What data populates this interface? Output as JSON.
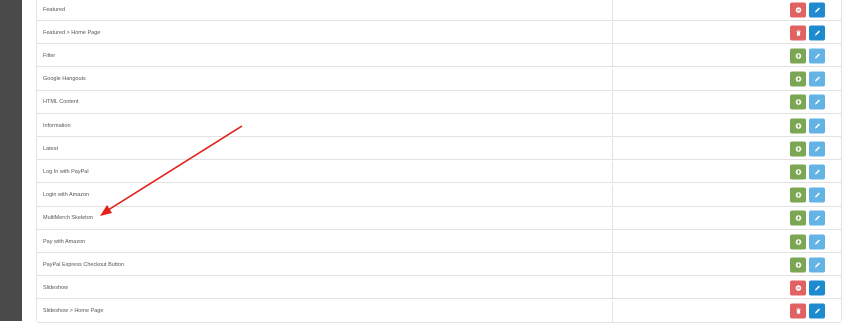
{
  "colors": {
    "sidebar": "#4a4a4a",
    "danger": "#e06262",
    "success": "#7ba653",
    "primary": "#1e8acf",
    "info": "#63b3e5",
    "arrow": "#e3201b"
  },
  "rows": [
    {
      "name": "Featured",
      "status_action": "uninstall",
      "status_icon": "minus-circle-icon",
      "edit_enabled": true
    },
    {
      "name": "Featured > Home Page",
      "status_action": "delete",
      "status_icon": "trash-icon",
      "edit_enabled": true
    },
    {
      "name": "Filter",
      "status_action": "install",
      "status_icon": "plus-circle-icon",
      "edit_enabled": false
    },
    {
      "name": "Google Hangouts",
      "status_action": "install",
      "status_icon": "plus-circle-icon",
      "edit_enabled": false
    },
    {
      "name": "HTML Content",
      "status_action": "install",
      "status_icon": "plus-circle-icon",
      "edit_enabled": false
    },
    {
      "name": "Information",
      "status_action": "install",
      "status_icon": "plus-circle-icon",
      "edit_enabled": false
    },
    {
      "name": "Latest",
      "status_action": "install",
      "status_icon": "plus-circle-icon",
      "edit_enabled": false
    },
    {
      "name": "Log In with PayPal",
      "status_action": "install",
      "status_icon": "plus-circle-icon",
      "edit_enabled": false
    },
    {
      "name": "Login with Amazon",
      "status_action": "install",
      "status_icon": "plus-circle-icon",
      "edit_enabled": false
    },
    {
      "name": "MultiMerch Skeleton",
      "status_action": "install",
      "status_icon": "plus-circle-icon",
      "edit_enabled": false
    },
    {
      "name": "Pay with Amazon",
      "status_action": "install",
      "status_icon": "plus-circle-icon",
      "edit_enabled": false
    },
    {
      "name": "PayPal Express Checkout Button",
      "status_action": "install",
      "status_icon": "plus-circle-icon",
      "edit_enabled": false
    },
    {
      "name": "Slideshow",
      "status_action": "uninstall",
      "status_icon": "minus-circle-icon",
      "edit_enabled": true
    },
    {
      "name": "Slideshow > Home Page",
      "status_action": "delete",
      "status_icon": "trash-icon",
      "edit_enabled": true
    }
  ]
}
